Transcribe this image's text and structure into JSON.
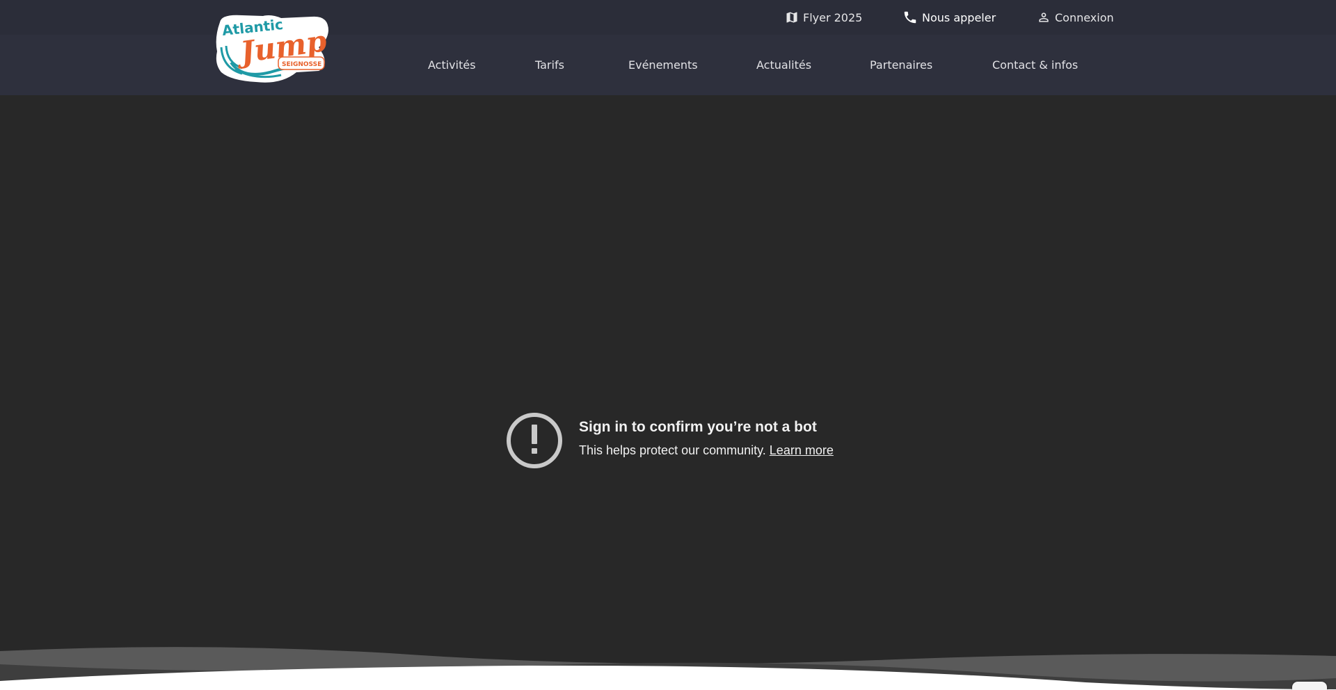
{
  "header": {
    "logo": {
      "name": "Atlantic Jump Seignosse logo",
      "line1": "Atlantic",
      "line2": "Jump",
      "line3": "SEIGNOSSE",
      "colors": {
        "teal": "#1f9aa6",
        "orange": "#e8612c",
        "white": "#ffffff"
      }
    },
    "topbar": {
      "flyer": {
        "icon": "map-icon",
        "label": "Flyer 2025"
      },
      "call": {
        "icon": "phone-icon",
        "label": "Nous appeler"
      },
      "login": {
        "icon": "user-icon",
        "label": "Connexion"
      }
    },
    "nav": [
      {
        "label": "Activités"
      },
      {
        "label": "Tarifs"
      },
      {
        "label": "Evénements"
      },
      {
        "label": "Actualités"
      },
      {
        "label": "Partenaires"
      },
      {
        "label": "Contact & infos"
      }
    ],
    "colors": {
      "background": "#2e303d",
      "topbar": "#2b2d39",
      "text": "#e2e2e6"
    }
  },
  "video_embed": {
    "background": "#282828",
    "notice": {
      "icon": "alert-circle-icon",
      "title": "Sign in to confirm you’re not a bot",
      "body": "This helps protect our community.",
      "link": "Learn more"
    }
  },
  "footer_wave": {
    "colors": [
      "#5a5a5a",
      "#3e3e3e",
      "#ffffff"
    ]
  }
}
